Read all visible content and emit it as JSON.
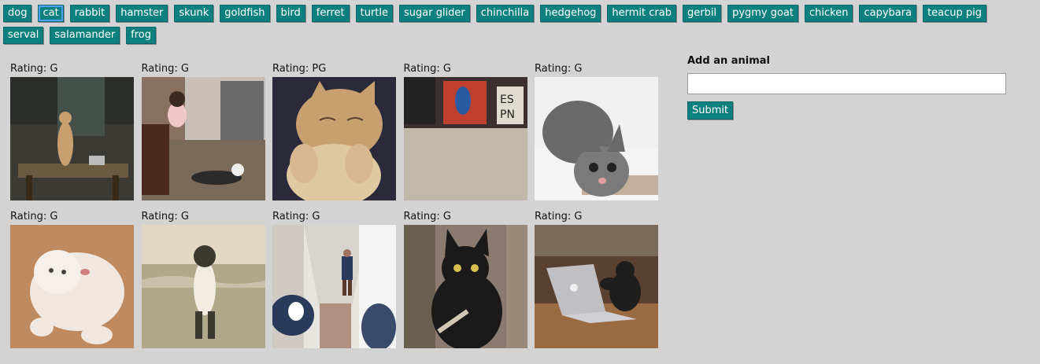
{
  "topics": [
    {
      "label": "dog",
      "active": false
    },
    {
      "label": "cat",
      "active": true
    },
    {
      "label": "rabbit",
      "active": false
    },
    {
      "label": "hamster",
      "active": false
    },
    {
      "label": "skunk",
      "active": false
    },
    {
      "label": "goldfish",
      "active": false
    },
    {
      "label": "bird",
      "active": false
    },
    {
      "label": "ferret",
      "active": false
    },
    {
      "label": "turtle",
      "active": false
    },
    {
      "label": "sugar glider",
      "active": false
    },
    {
      "label": "chinchilla",
      "active": false
    },
    {
      "label": "hedgehog",
      "active": false
    },
    {
      "label": "hermit crab",
      "active": false
    },
    {
      "label": "gerbil",
      "active": false
    },
    {
      "label": "pygmy goat",
      "active": false
    },
    {
      "label": "chicken",
      "active": false
    },
    {
      "label": "capybara",
      "active": false
    },
    {
      "label": "teacup pig",
      "active": false
    },
    {
      "label": "serval",
      "active": false
    },
    {
      "label": "salamander",
      "active": false
    },
    {
      "label": "frog",
      "active": false
    }
  ],
  "gifs": [
    {
      "rating": "Rating: G",
      "scene": "cat-standing-table",
      "colors": [
        "#3b3a34",
        "#6a5a40",
        "#c8a070"
      ]
    },
    {
      "rating": "Rating: G",
      "scene": "toddler-kitchen-cat",
      "colors": [
        "#7a6a5a",
        "#b0a090",
        "#2a2a2a"
      ]
    },
    {
      "rating": "Rating: PG",
      "scene": "orange-cat-closeup",
      "colors": [
        "#2a2a3a",
        "#c8a070",
        "#e0c8a0"
      ]
    },
    {
      "rating": "Rating: G",
      "scene": "carpet-room",
      "colors": [
        "#3a3030",
        "#c0b8a8",
        "#e0dcd0"
      ]
    },
    {
      "rating": "Rating: G",
      "scene": "tabby-cat-crouching",
      "colors": [
        "#f0f0f0",
        "#6a6a6a",
        "#a08060"
      ]
    },
    {
      "rating": "Rating: G",
      "scene": "white-cat-rolling",
      "colors": [
        "#c08a60",
        "#f0e8e0",
        "#d0a080"
      ]
    },
    {
      "rating": "Rating: G",
      "scene": "cat-standing-beach",
      "colors": [
        "#b0a888",
        "#e0d8c0",
        "#3a3a30"
      ]
    },
    {
      "rating": "Rating: G",
      "scene": "hallway-man-cat",
      "colors": [
        "#e8e4e0",
        "#a0a0a0",
        "#2a3a5a"
      ]
    },
    {
      "rating": "Rating: G",
      "scene": "black-cat-knife",
      "colors": [
        "#8a7a70",
        "#1a1a1a",
        "#d0c8b0"
      ]
    },
    {
      "rating": "Rating: G",
      "scene": "cat-laptop",
      "colors": [
        "#5a4030",
        "#c0c0c4",
        "#9a6a40"
      ]
    }
  ],
  "form": {
    "label": "Add an animal",
    "input_value": "",
    "input_placeholder": "",
    "submit_label": "Submit"
  },
  "colors": {
    "accent": "#0f8080",
    "background": "#d3d3d3"
  }
}
